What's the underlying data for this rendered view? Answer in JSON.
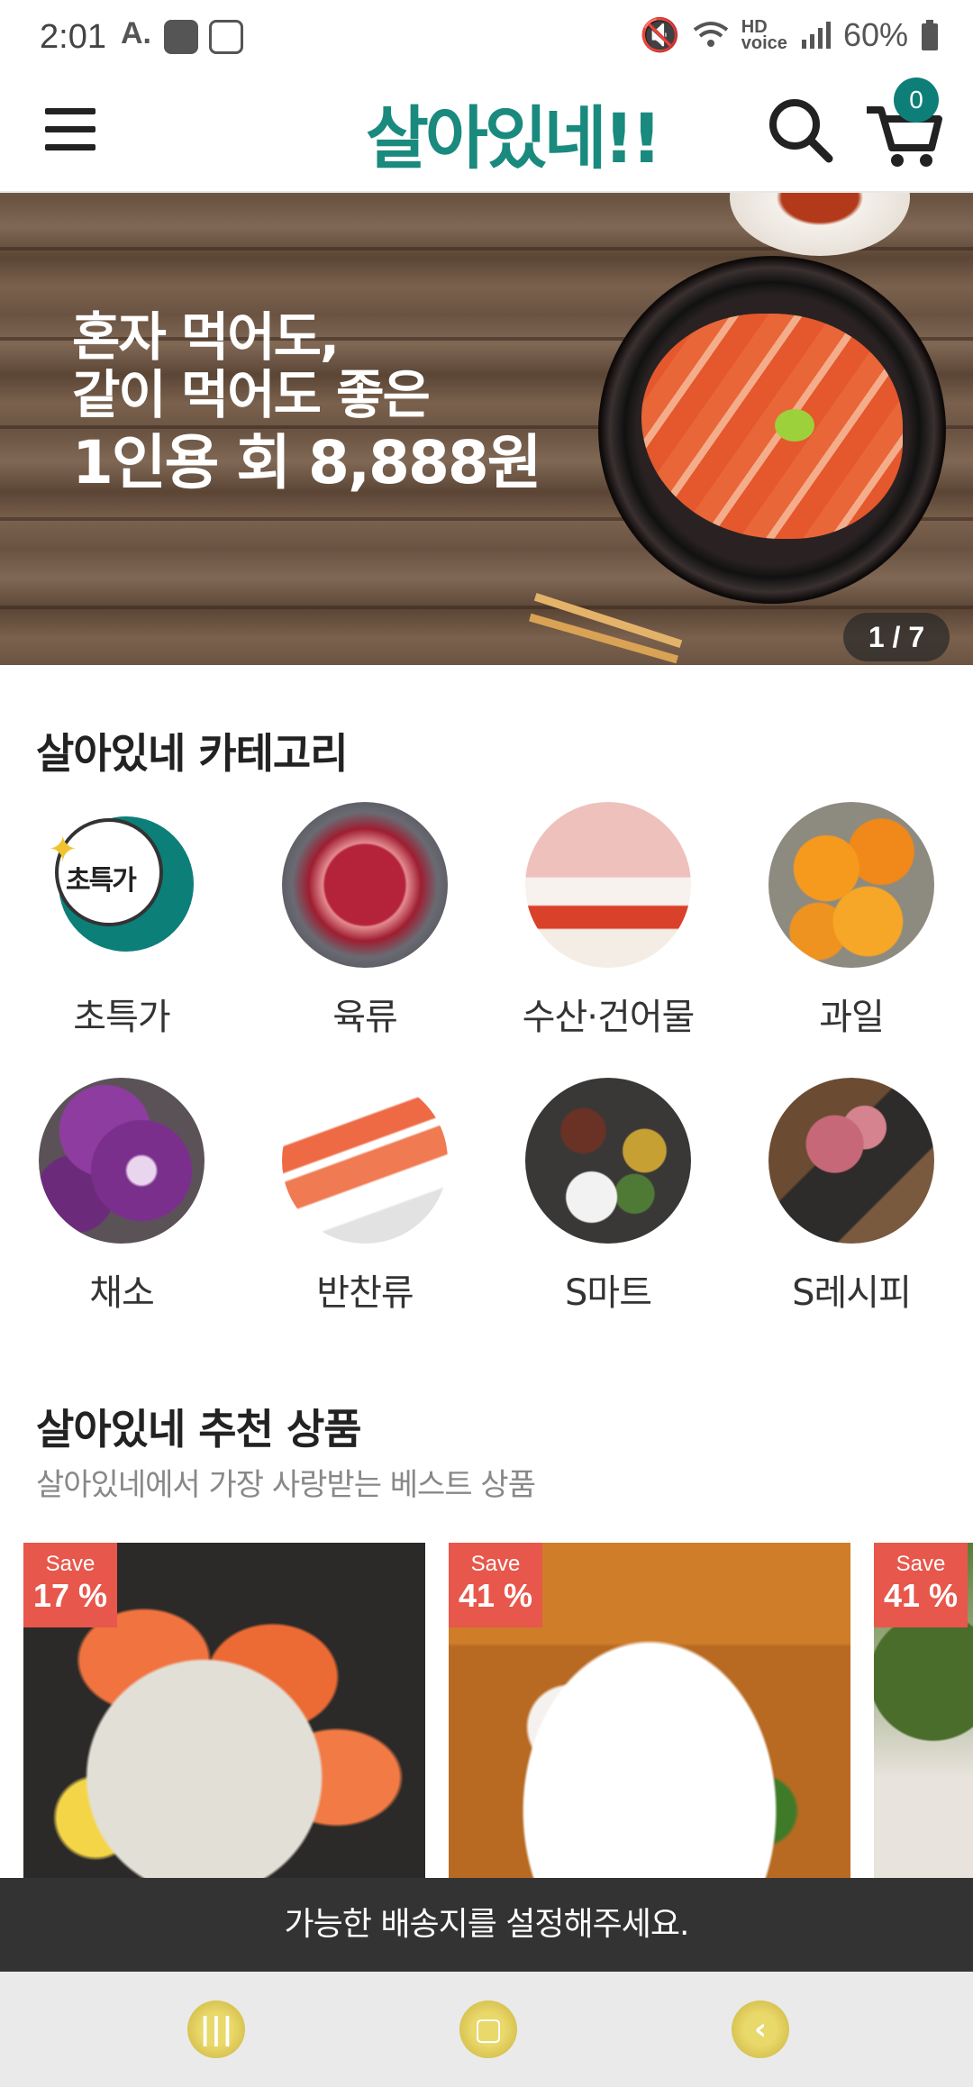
{
  "status_bar": {
    "time": "2:01",
    "battery": "60%",
    "icons": [
      "a-icon",
      "weather-icon",
      "media-icon",
      "mute-icon",
      "wifi-icon",
      "hd-voice-icon",
      "signal-icon",
      "battery-icon"
    ]
  },
  "header": {
    "logo": "살아있네!!",
    "cart_count": "0",
    "menu_icon": "hamburger-menu-icon",
    "search_icon": "search-icon",
    "cart_icon": "cart-icon"
  },
  "banner": {
    "line1": "혼자 먹어도,",
    "line2": "같이 먹어도 좋은",
    "line3": "1인용 회 8,888원",
    "counter": "1 / 7"
  },
  "categories": {
    "title": "살아있네 카테고리",
    "special_badge": "초특가",
    "items": [
      {
        "label": "초특가"
      },
      {
        "label": "육류"
      },
      {
        "label": "수산·건어물"
      },
      {
        "label": "과일"
      },
      {
        "label": "채소"
      },
      {
        "label": "반찬류"
      },
      {
        "label": "S마트"
      },
      {
        "label": "S레시피"
      }
    ]
  },
  "recommended": {
    "title": "살아있네 추천 상품",
    "subtitle": "살아있네에서 가장 사랑받는 베스트 상품",
    "products": [
      {
        "save_label": "Save",
        "discount": "17 %"
      },
      {
        "save_label": "Save",
        "discount": "41 %"
      },
      {
        "save_label": "Save",
        "discount": "41 %"
      }
    ]
  },
  "toast": {
    "message": "가능한 배송지를 설정해주세요."
  },
  "nav": {
    "icons": [
      "recent-apps-icon",
      "home-icon",
      "back-icon"
    ]
  },
  "colors": {
    "brand": "#1a8a7e",
    "badge": "#0d7f78",
    "save": "#e8574b"
  }
}
